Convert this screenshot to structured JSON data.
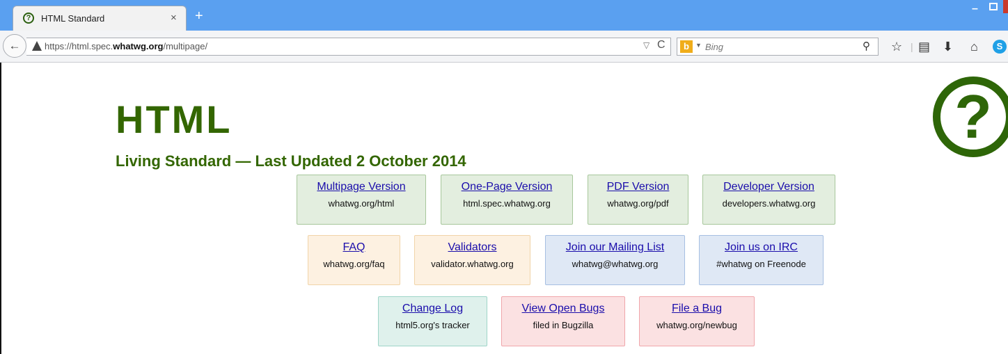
{
  "browser": {
    "tab": {
      "title": "HTML Standard",
      "close": "×"
    },
    "new_tab": "+",
    "window_controls": {
      "minimize": "–"
    },
    "url": {
      "prefix": "https://html.spec.",
      "domain": "whatwg.org",
      "path": "/multipage/"
    },
    "search": {
      "engine": "Bing",
      "placeholder": "Bing"
    },
    "icons": [
      "back-icon",
      "warning-icon",
      "reload-icon",
      "bing-icon",
      "search-icon",
      "star-icon",
      "reading-list-icon",
      "download-icon",
      "home-icon",
      "skype-icon"
    ]
  },
  "page": {
    "title": "HTML",
    "subtitle": "Living Standard — Last Updated 2 October 2014",
    "logo_symbol": "?",
    "heading_color": "#336600"
  },
  "links": {
    "row1": [
      {
        "label": "Multipage Version",
        "sub": "whatwg.org/html",
        "color": "green"
      },
      {
        "label": "One-Page Version",
        "sub": "html.spec.whatwg.org",
        "color": "green"
      },
      {
        "label": "PDF Version",
        "sub": "whatwg.org/pdf",
        "color": "green"
      },
      {
        "label": "Developer Version",
        "sub": "developers.whatwg.org",
        "color": "green"
      }
    ],
    "row2": [
      {
        "label": "FAQ",
        "sub": "whatwg.org/faq",
        "color": "orange"
      },
      {
        "label": "Validators",
        "sub": "validator.whatwg.org",
        "color": "orange"
      },
      {
        "label": "Join our Mailing List",
        "sub": "whatwg@whatwg.org",
        "color": "blue"
      },
      {
        "label": "Join us on IRC",
        "sub": "#whatwg on Freenode",
        "color": "blue"
      }
    ],
    "row3": [
      {
        "label": "Change Log",
        "sub": "html5.org's tracker",
        "color": "teal"
      },
      {
        "label": "View Open Bugs",
        "sub": "filed in Bugzilla",
        "color": "red"
      },
      {
        "label": "File a Bug",
        "sub": "whatwg.org/newbug",
        "color": "red"
      }
    ]
  }
}
